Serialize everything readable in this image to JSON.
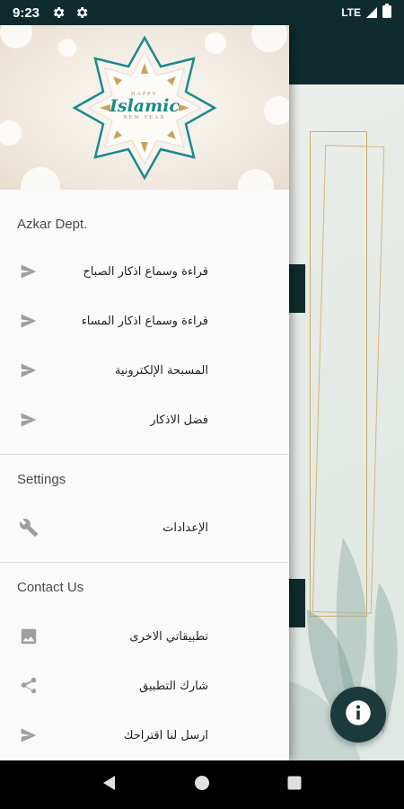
{
  "status_bar": {
    "time": "9:23",
    "network": "LTE",
    "icons": [
      "settings-gear-icon",
      "settings-gear-icon",
      "signal-icon",
      "battery-icon"
    ]
  },
  "header_banner": {
    "top_text": "HAPPY",
    "main_text": "Islamic",
    "bottom_text": "NEW YEAR"
  },
  "drawer": {
    "sections": [
      {
        "title": "Azkar Dept.",
        "items": [
          {
            "label": "قراءة وسماع اذكار الصباح",
            "icon": "send-icon"
          },
          {
            "label": "قراءة وسماع اذكار المساء",
            "icon": "send-icon"
          },
          {
            "label": "المسبحة الإلكترونية",
            "icon": "send-icon"
          },
          {
            "label": "فضل الاذكار",
            "icon": "send-icon"
          }
        ]
      },
      {
        "title": "Settings",
        "items": [
          {
            "label": "الإعدادات",
            "icon": "wrench-icon"
          }
        ]
      },
      {
        "title": "Contact Us",
        "items": [
          {
            "label": "تطبيقاتي الاخرى",
            "icon": "image-icon"
          },
          {
            "label": "شارك التطبيق",
            "icon": "share-icon"
          },
          {
            "label": "ارسل لنا اقتراحك",
            "icon": "send-icon"
          }
        ]
      }
    ]
  },
  "fab": {
    "icon": "info-icon"
  },
  "navigation": {
    "icons": [
      "back-icon",
      "home-icon",
      "recents-icon"
    ]
  },
  "colors": {
    "primary_dark": "#0f2b2d",
    "drawer_bg": "#fafafa",
    "icon_gray": "#9e9e9e",
    "teal_accent": "#1a8a8c",
    "gold_accent": "#c9a35a"
  }
}
